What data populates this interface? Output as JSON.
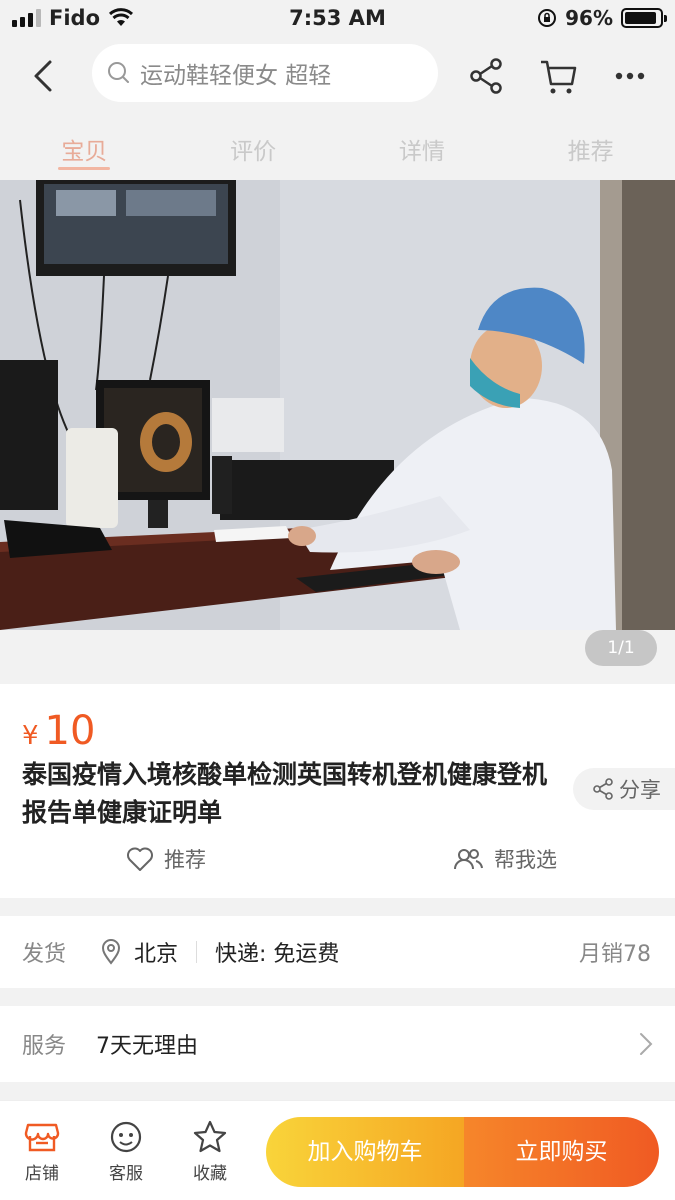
{
  "status_bar": {
    "carrier": "Fido",
    "time": "7:53 AM",
    "battery": "96%"
  },
  "nav": {
    "search_placeholder": "运动鞋轻便女 超轻"
  },
  "tabs": [
    {
      "label": "宝贝",
      "active": true
    },
    {
      "label": "评价",
      "active": false
    },
    {
      "label": "详情",
      "active": false
    },
    {
      "label": "推荐",
      "active": false
    }
  ],
  "gallery": {
    "page_indicator": "1/1"
  },
  "product": {
    "currency_symbol": "¥",
    "price": "10",
    "title": "泰国疫情入境核酸单检测英国转机登机健康登机报告单健康证明单",
    "share_label": "分享",
    "recommend_label": "推荐",
    "help_choose_label": "帮我选"
  },
  "shipping": {
    "label": "发货",
    "location": "北京",
    "courier": "快递: 免运费",
    "monthly_sales": "月销78"
  },
  "service": {
    "label": "服务",
    "value": "7天无理由"
  },
  "bottom_bar": {
    "shop_label": "店铺",
    "service_label": "客服",
    "favorite_label": "收藏",
    "add_to_cart_label": "加入购物车",
    "buy_now_label": "立即购买"
  },
  "colors": {
    "accent": "#f05a23",
    "cart_button": "#f5a623",
    "tab_active": "#e8ab98"
  }
}
